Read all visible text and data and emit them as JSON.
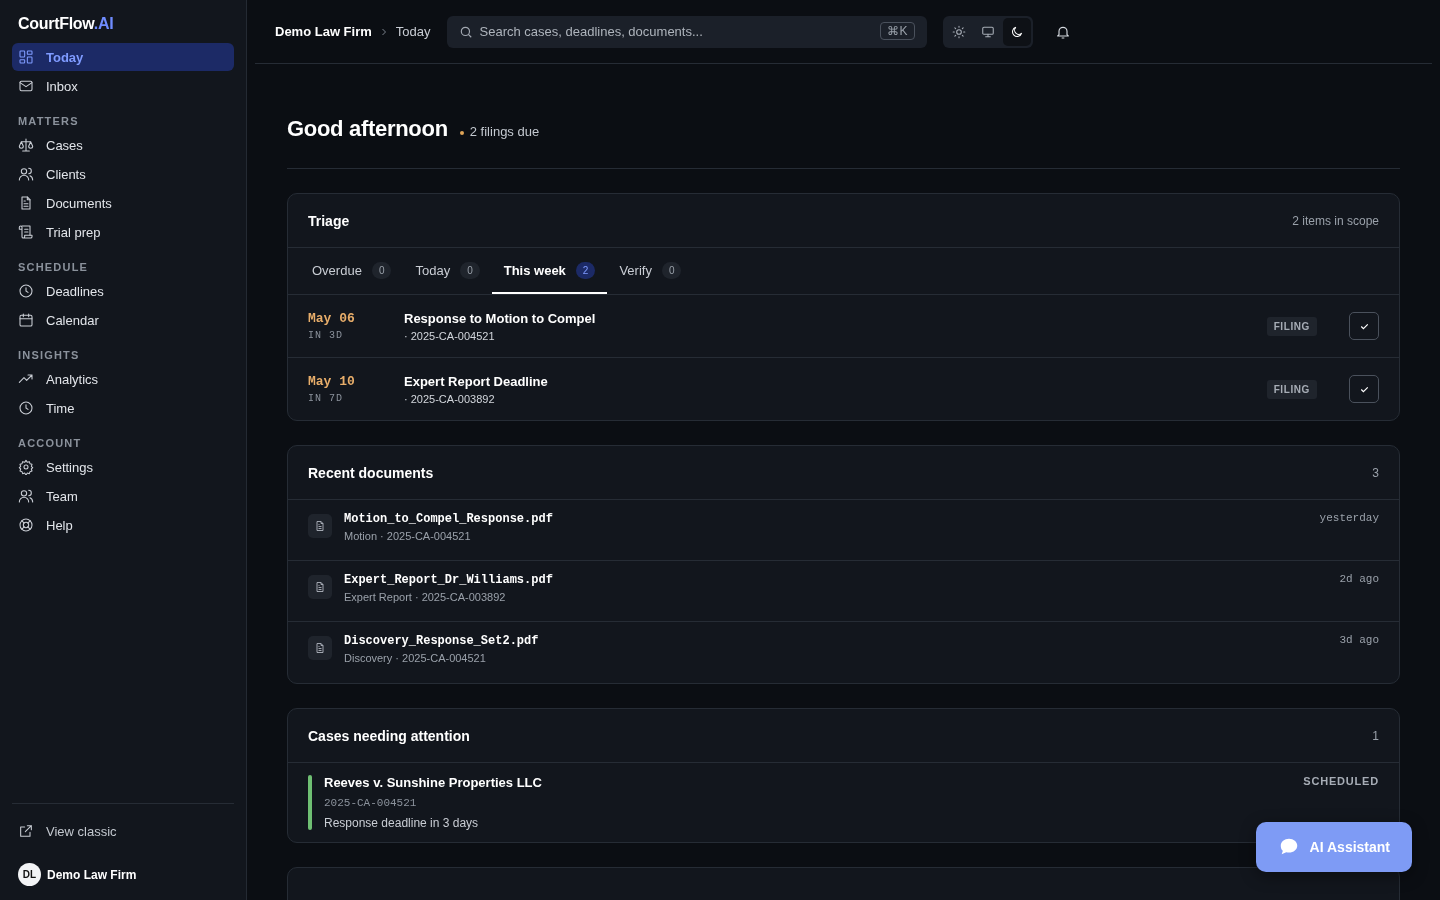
{
  "sidebar": {
    "logo": {
      "text": "CourtFlow",
      "accent": ".AI"
    },
    "sections": [
      {
        "items": [
          {
            "label": "Today",
            "selected": true
          },
          {
            "label": "Inbox",
            "selected": false
          }
        ]
      },
      {
        "heading": "MATTERS",
        "items": [
          {
            "label": "Cases",
            "selected": false
          },
          {
            "label": "Clients",
            "selected": false
          },
          {
            "label": "Documents",
            "selected": false
          },
          {
            "label": "Trial prep",
            "selected": false
          }
        ]
      },
      {
        "heading": "SCHEDULE",
        "items": [
          {
            "label": "Deadlines",
            "selected": false
          },
          {
            "label": "Calendar",
            "selected": false
          }
        ]
      },
      {
        "heading": "INSIGHTS",
        "items": [
          {
            "label": "Analytics",
            "selected": false
          },
          {
            "label": "Time",
            "selected": false
          }
        ]
      },
      {
        "heading": "ACCOUNT",
        "items": [
          {
            "label": "Settings",
            "selected": false
          },
          {
            "label": "Team",
            "selected": false
          },
          {
            "label": "Help",
            "selected": false
          }
        ]
      }
    ],
    "view_classic": "View classic",
    "user": {
      "initials": "DL",
      "name": "Demo Law Firm"
    }
  },
  "topbar": {
    "breadcrumb": [
      "Demo Law Firm",
      "Today"
    ],
    "search": {
      "placeholder": "Search cases, deadlines, documents...",
      "shortcut": "⌘K"
    },
    "theme_modes": [
      {
        "selected": false
      },
      {
        "selected": false
      },
      {
        "selected": true
      }
    ]
  },
  "greeting": {
    "title": "Good afternoon",
    "status": "2 filings due",
    "color": "#e0a458"
  },
  "triage": {
    "title": "Triage",
    "meta": "2 items in scope",
    "tabs": [
      {
        "label": "Overdue",
        "count": "0",
        "selected": false
      },
      {
        "label": "Today",
        "count": "0",
        "selected": false
      },
      {
        "label": "This week",
        "count": "2",
        "selected": true
      },
      {
        "label": "Verify",
        "count": "0",
        "selected": false
      }
    ],
    "rows": [
      {
        "date": "May 06",
        "relative": "IN 3D",
        "title": "Response to Motion to Compel",
        "case": "· 2025-CA-004521",
        "tag": "FILING"
      },
      {
        "date": "May 10",
        "relative": "IN 7D",
        "title": "Expert Report Deadline",
        "case": "· 2025-CA-003892",
        "tag": "FILING"
      }
    ]
  },
  "recent_documents": {
    "title": "Recent documents",
    "count": "3",
    "items": [
      {
        "name": "Motion_to_Compel_Response.pdf",
        "meta": "Motion · 2025-CA-004521",
        "time": "yesterday"
      },
      {
        "name": "Expert_Report_Dr_Williams.pdf",
        "meta": "Expert Report · 2025-CA-003892",
        "time": "2d ago"
      },
      {
        "name": "Discovery_Response_Set2.pdf",
        "meta": "Discovery · 2025-CA-004521",
        "time": "3d ago"
      }
    ]
  },
  "cases_attention": {
    "title": "Cases needing attention",
    "count": "1",
    "items": [
      {
        "title": "Reeves v. Sunshine Properties LLC",
        "case_number": "2025-CA-004521",
        "note": "Response deadline in 3 days",
        "status": "SCHEDULED",
        "color": "#6fbf73"
      }
    ]
  },
  "ai_button": "AI Assistant"
}
